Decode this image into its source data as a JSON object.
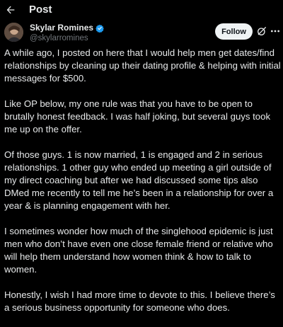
{
  "header": {
    "back_icon": "arrow-left-icon",
    "title": "Post"
  },
  "author": {
    "display_name": "Skylar Romines",
    "handle": "@skylarromines",
    "verified": true,
    "verified_color": "#1d9bf0",
    "follow_label": "Follow",
    "grok_icon": "grok-icon",
    "more_icon": "more-dots-icon"
  },
  "post": {
    "paragraphs": [
      "A while ago, I posted on here that I would help men get dates/find relationships by cleaning up their dating profile & helping with initial messages for $500.",
      "Like OP below, my one rule was that you have to be open to brutally honest feedback. I was half joking, but several guys took me up on the offer.",
      "Of those guys. 1 is now married, 1 is engaged and 2 in serious relationships. 1 other guy who ended up meeting a girl outside of my direct coaching but after we had discussed some tips also DMed me recently to tell me he’s been in a relationship for over a year & is planning engagement with her.",
      "I sometimes wonder how much of the singlehood epidemic is just men who don’t have even one close female friend or relative who will help them understand how women think & how to talk to women.",
      "Honestly, I wish I had more time to devote to this. I believe there’s a serious business opportunity for someone who does."
    ]
  },
  "colors": {
    "background": "#000000",
    "text": "#e7e9ea",
    "secondary_text": "#71767b",
    "follow_bg": "#eff3f4"
  }
}
